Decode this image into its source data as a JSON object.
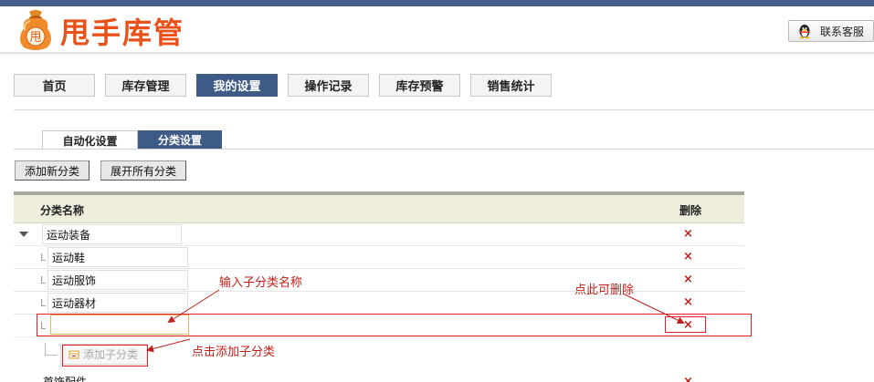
{
  "brand": {
    "name": "甩手库管",
    "logo_glyph": "甩"
  },
  "header": {
    "contact_label": "联系客服"
  },
  "nav": [
    {
      "label": "首页"
    },
    {
      "label": "库存管理"
    },
    {
      "label": "我的设置",
      "active": true
    },
    {
      "label": "操作记录"
    },
    {
      "label": "库存预警"
    },
    {
      "label": "销售统计"
    }
  ],
  "subtabs": [
    {
      "label": "自动化设置"
    },
    {
      "label": "分类设置",
      "active": true
    }
  ],
  "toolbar": {
    "add_category": "添加新分类",
    "expand_all": "展开所有分类"
  },
  "table": {
    "col_name": "分类名称",
    "col_delete": "删除",
    "parent": "运动装备",
    "children": [
      "运动鞋",
      "运动服饰",
      "运动器材"
    ],
    "new_child_value": "",
    "add_child_label": "添加子分类",
    "delete_glyph": "×",
    "branch_glyph": "L",
    "next_parent_partial": "首饰配件"
  },
  "annotations": {
    "input_hint": "输入子分类名称",
    "delete_hint": "点此可删除",
    "add_hint": "点击添加子分类",
    "color": "#c0201a"
  },
  "colors": {
    "accent": "#3e5a87",
    "brand": "#e8511a",
    "delete": "#c0201a"
  }
}
